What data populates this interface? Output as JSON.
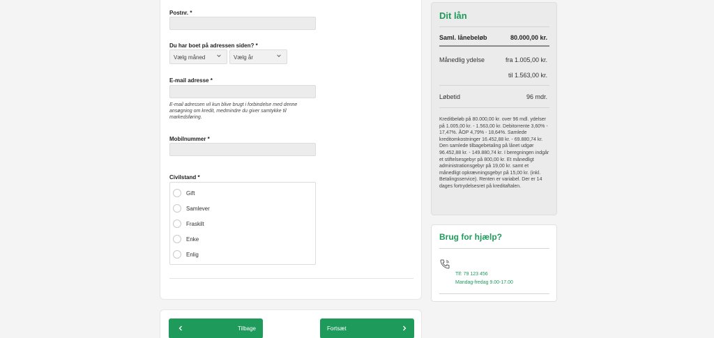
{
  "form": {
    "postnr_label": "Postnr. *",
    "postnr_value": "",
    "since_label": "Du har boet på adressen siden? *",
    "month_select": "Vælg måned",
    "year_select": "Vælg år",
    "email_label": "E-mail adresse *",
    "email_value": "",
    "email_help": "E-mail adressen vil kun blive brugt i forbindelse med denne ansøgning om kredit, medmindre du giver samtykke til markedsføring.",
    "mobile_label": "Mobilnummer *",
    "mobile_value": "",
    "civil_label": "Civilstand *",
    "civil_options": [
      "Gift",
      "Samlever",
      "Fraskilt",
      "Enke",
      "Enlig"
    ]
  },
  "nav": {
    "back_label": "Tilbage",
    "next_label": "Fortsæt"
  },
  "loan": {
    "title": "Dit lån",
    "total_label": "Saml. lånebeløb",
    "total_value": "80.000,00 kr.",
    "monthly_label": "Månedlig ydelse",
    "monthly_from": "fra 1.005,00 kr.",
    "monthly_to": "til 1.563,00 kr.",
    "term_label": "Løbetid",
    "term_value": "96 mdr.",
    "legal_text": "Kreditbeløb på 80.000,00 kr. over 96 mdl. ydelser på 1.005,00 kr. - 1.563,00 kr. Debitorrente 3,60% - 17,47%. ÅOP 4,79% - 18,64%. Samlede kreditomkostninger 16.452,88 kr. - 69.880,74 kr. Den samlede tilbagebetaling på lånet udgør 96.452,88 kr. - 149.880,74 kr. I beregningen indgår et stiftelsesgebyr på 800,00 kr. Et månedligt administrationsgebyr på 19,00 kr. samt et månedligt opkrævningsgebyr på 15,00 kr. (inkl. Betalingsservice). Renten er variabel. Der er 14 dages fortrydelsesret på kreditaftalen."
  },
  "help": {
    "title": "Brug for hjælp?",
    "phone": "Tlf: 79 123 456",
    "hours": "Mandag-fredag 9.00-17.00"
  },
  "colors": {
    "accent": "#1e9a5a",
    "panel_bg": "#ebebeb",
    "page_bg": "#f4f4f4"
  },
  "icons": {
    "select": "chevron-down-icon",
    "back": "chevron-left-icon",
    "next": "chevron-right-icon",
    "help": "phone-icon"
  }
}
